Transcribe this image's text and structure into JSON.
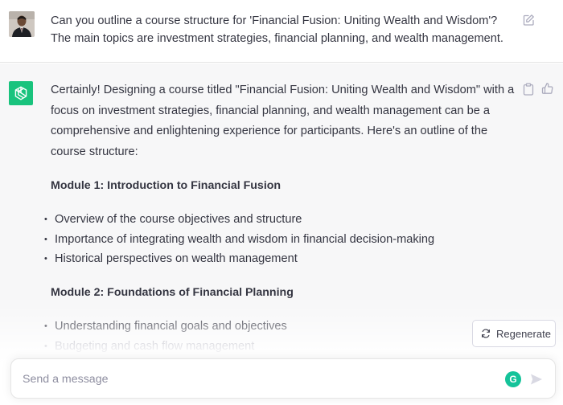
{
  "user_message": {
    "text": "Can you outline a course structure for 'Financial Fusion: Uniting Wealth and Wisdom'? The main topics are investment strategies, financial planning, and wealth management."
  },
  "assistant_message": {
    "intro": "Certainly! Designing a course titled \"Financial Fusion: Uniting Wealth and Wisdom\" with a focus on investment strategies, financial planning, and wealth management can be a comprehensive and enlightening experience for participants. Here's an outline of the course structure:",
    "modules": [
      {
        "title": "Module 1: Introduction to Financial Fusion",
        "items": [
          "Overview of the course objectives and structure",
          "Importance of integrating wealth and wisdom in financial decision-making",
          "Historical perspectives on wealth management"
        ]
      },
      {
        "title": "Module 2: Foundations of Financial Planning",
        "items": [
          "Understanding financial goals and objectives",
          "Budgeting and cash flow management"
        ]
      }
    ]
  },
  "controls": {
    "regenerate_label": "Regenerate",
    "input_placeholder": "Send a message",
    "grammarly_letter": "G"
  },
  "icons": {
    "edit": "edit-icon",
    "copy": "clipboard-icon",
    "thumbs_up": "thumbs-up-icon",
    "regenerate": "refresh-icon",
    "send": "send-icon",
    "assistant_logo": "openai-logo-icon"
  },
  "colors": {
    "assistant_avatar": "#19c37d",
    "grammarly": "#15c39a",
    "assistant_bg": "#f7f7f8"
  }
}
